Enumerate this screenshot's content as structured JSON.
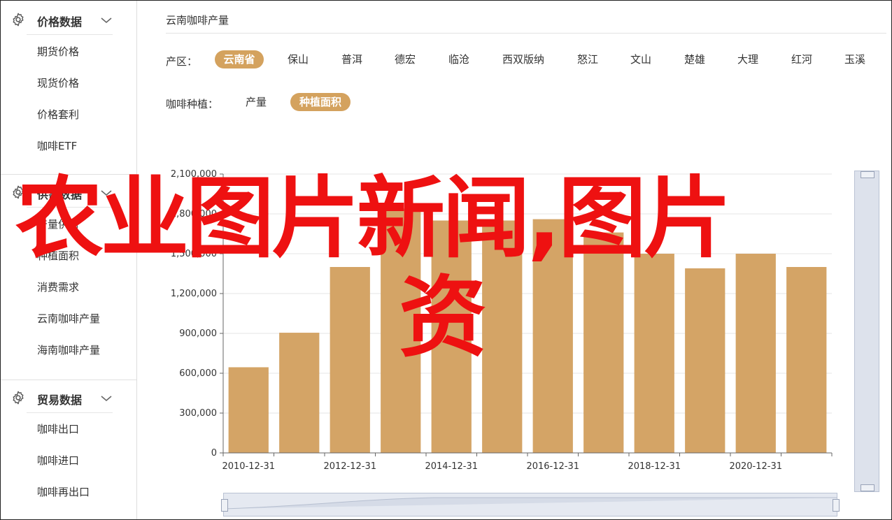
{
  "sidebar": {
    "groups": [
      {
        "title": "价格数据",
        "items": [
          "期货价格",
          "现货价格",
          "价格套利",
          "咖啡ETF"
        ]
      },
      {
        "title": "供需数据",
        "items": [
          "产量供给",
          "种植面积",
          "消费需求",
          "云南咖啡产量",
          "海南咖啡产量"
        ]
      },
      {
        "title": "贸易数据",
        "items": [
          "咖啡出口",
          "咖啡进口",
          "咖啡再出口"
        ]
      }
    ]
  },
  "page": {
    "title": "云南咖啡产量"
  },
  "filters": {
    "region_label": "产区：",
    "regions": [
      "云南省",
      "保山",
      "普洱",
      "德宏",
      "临沧",
      "西双版纳",
      "怒江",
      "文山",
      "楚雄",
      "大理",
      "红河",
      "玉溪"
    ],
    "region_selected": "云南省",
    "crop_label": "咖啡种植：",
    "crops": [
      "产量",
      "种植面积"
    ],
    "crop_selected": "种植面积"
  },
  "chart_data": {
    "type": "bar",
    "x": [
      "2010-12-31",
      "2011-12-31",
      "2012-12-31",
      "2013-12-31",
      "2014-12-31",
      "2015-12-31",
      "2016-12-31",
      "2017-12-31",
      "2018-12-31",
      "2019-12-31",
      "2020-12-31",
      "2021-12-31"
    ],
    "x_tick_labels": [
      "2010-12-31",
      "2012-12-31",
      "2014-12-31",
      "2016-12-31",
      "2018-12-31",
      "2020-12-31"
    ],
    "values": [
      645000,
      905000,
      1400000,
      1840000,
      1750000,
      1750000,
      1760000,
      1660000,
      1500000,
      1390000,
      1500000,
      1400000
    ],
    "ylim": [
      0,
      2100000
    ],
    "y_ticks": [
      0,
      300000,
      600000,
      900000,
      1200000,
      1500000,
      1800000,
      2100000
    ],
    "y_tick_labels": [
      "0",
      "300,000",
      "600,000",
      "900,000",
      "1,200,000",
      "1,500,000",
      "1,800,000",
      "2,100,000"
    ],
    "grid": true,
    "bar_color": "#d4a466"
  },
  "overlay": {
    "line1": "农业图片新闻,图片",
    "line2": "资"
  },
  "colors": {
    "accent": "#d4a25e",
    "overlay_text": "#ee1111"
  }
}
